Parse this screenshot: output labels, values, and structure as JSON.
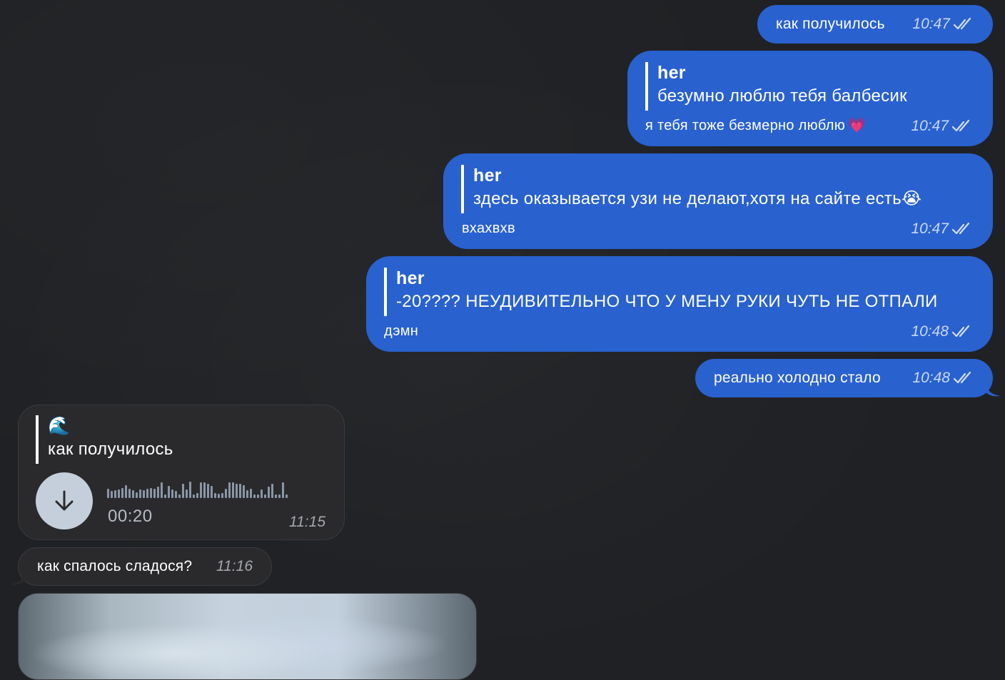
{
  "messages": {
    "m1": {
      "text": "как получилось",
      "time": "10:47"
    },
    "m2": {
      "reply_author": "her",
      "reply_text": "безумно люблю тебя балбесик",
      "text": "я тебя тоже безмерно люблю",
      "emoji": "💗",
      "time": "10:47"
    },
    "m3": {
      "reply_author": "her",
      "reply_text": "здесь оказывается узи не делают,хотя на сайте есть",
      "reply_emoji": "😭",
      "text": "вхахвхв",
      "time": "10:47"
    },
    "m4": {
      "reply_author": "her",
      "reply_text": "-20???? НЕУДИВИТЕЛЬНО ЧТО У МЕНУ РУКИ ЧУТЬ НЕ ОТПАЛИ",
      "text": "дэмн",
      "time": "10:48"
    },
    "m5": {
      "text": "реально холодно стало",
      "time": "10:48"
    },
    "m6": {
      "reply_author": "🌊",
      "reply_text": "как получилось",
      "voice_duration": "00:20",
      "time": "11:15"
    },
    "m7": {
      "text": "как спалось сладося?",
      "time": "11:16"
    }
  },
  "icons": {
    "read_status": "double-check-icon",
    "download": "download-arrow-icon"
  },
  "colors": {
    "outgoing": "#2961cf",
    "incoming": "#2a2a2c",
    "background": "#1f2124"
  },
  "voice_waveform_levels": [
    0.55,
    0.4,
    0.45,
    0.5,
    0.6,
    0.75,
    0.55,
    0.45,
    0.35,
    0.5,
    0.45,
    0.55,
    0.6,
    0.55,
    0.65,
    0.9,
    0.2,
    0.7,
    0.5,
    0.4,
    0.2,
    0.85,
    0.5,
    0.95,
    0.2,
    0.3,
    0.9,
    0.9,
    0.85,
    0.7,
    0.3,
    0.25,
    0.3,
    0.55,
    0.9,
    0.9,
    0.85,
    0.85,
    0.75,
    0.45,
    0.55,
    0.2,
    0.2,
    0.5,
    0.2,
    0.65,
    0.85,
    0.2,
    0.2,
    0.9,
    0.2
  ]
}
